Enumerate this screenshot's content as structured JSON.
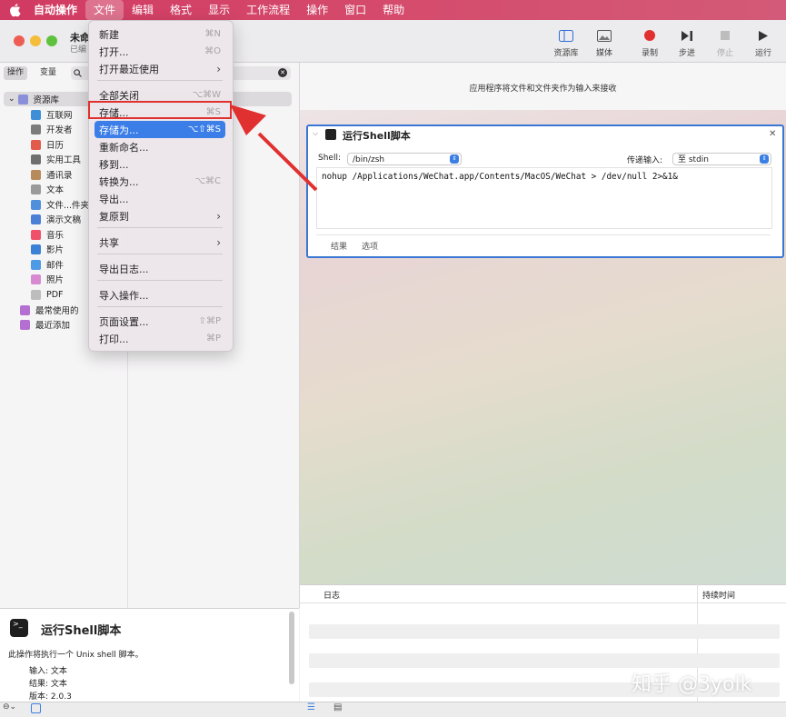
{
  "menubar": {
    "items": [
      "自动操作",
      "文件",
      "编辑",
      "格式",
      "显示",
      "工作流程",
      "操作",
      "窗口",
      "帮助"
    ],
    "active_index": 1
  },
  "window": {
    "title": "未命",
    "subtitle": "已编"
  },
  "toolbar": {
    "library": "资源库",
    "media": "媒体",
    "record": "录制",
    "step": "步进",
    "stop": "停止",
    "run": "运行"
  },
  "left_tabs": {
    "actions": "操作",
    "variables": "变量"
  },
  "library_tree": [
    {
      "label": "资源库",
      "color": "#8a8fd9"
    },
    {
      "label": "互联网",
      "color": "#3f8fd8"
    },
    {
      "label": "开发者",
      "color": "#7c7c7c"
    },
    {
      "label": "日历",
      "color": "#e25a4b"
    },
    {
      "label": "实用工具",
      "color": "#6f6f6f"
    },
    {
      "label": "通讯录",
      "color": "#b78a5b"
    },
    {
      "label": "文本",
      "color": "#9a9a9a"
    },
    {
      "label": "文件...件夹",
      "color": "#4f8fdc"
    },
    {
      "label": "演示文稿",
      "color": "#4c7fd6"
    },
    {
      "label": "音乐",
      "color": "#f0506a"
    },
    {
      "label": "影片",
      "color": "#3b82d6"
    },
    {
      "label": "邮件",
      "color": "#4d9be6"
    },
    {
      "label": "照片",
      "color": "#d78ad0"
    },
    {
      "label": "PDF",
      "color": "#bdbdbd"
    },
    {
      "label": "最常使用的",
      "color": "#b46fd2"
    },
    {
      "label": "最近添加",
      "color": "#b46fd2"
    }
  ],
  "file_menu": [
    {
      "label": "新建",
      "shortcut": "⌘N"
    },
    {
      "label": "打开...",
      "shortcut": "⌘O"
    },
    {
      "label": "打开最近使用",
      "shortcut": ""
    },
    {
      "label": "全部关闭",
      "shortcut": "⌥⌘W"
    },
    {
      "label": "存储...",
      "shortcut": "⌘S"
    },
    {
      "label": "存储为...",
      "shortcut": "⌥⇧⌘S"
    },
    {
      "label": "重新命名...",
      "shortcut": ""
    },
    {
      "label": "移到...",
      "shortcut": ""
    },
    {
      "label": "转换为...",
      "shortcut": "⌥⌘C"
    },
    {
      "label": "导出...",
      "shortcut": ""
    },
    {
      "label": "复原到",
      "shortcut": ""
    },
    {
      "label": "共享",
      "shortcut": ""
    },
    {
      "label": "导出日志...",
      "shortcut": ""
    },
    {
      "label": "导入操作...",
      "shortcut": ""
    },
    {
      "label": "页面设置...",
      "shortcut": "⇧⌘P"
    },
    {
      "label": "打印...",
      "shortcut": "⌘P"
    }
  ],
  "workflow": {
    "hint": "应用程序将文件和文件夹作为输入来接收",
    "action_title": "运行Shell脚本",
    "shell_label": "Shell:",
    "shell_value": "/bin/zsh",
    "input_label": "传递输入:",
    "input_value": "至 stdin",
    "script": "nohup /Applications/WeChat.app/Contents/MacOS/WeChat > /dev/null 2>&1&",
    "results_tab": "结果",
    "options_tab": "选项"
  },
  "log": {
    "col_log": "日志",
    "col_duration": "持续时间"
  },
  "description": {
    "title": "运行Shell脚本",
    "body": "此操作将执行一个 Unix shell 脚本。",
    "input": "输入: 文本",
    "result": "结果: 文本",
    "version": "版本: 2.0.3"
  },
  "watermark": "知乎 @3yolk",
  "colors": {
    "accent": "#3c7ee8",
    "highlight_box": "#e0302f",
    "menubar": "#d44468"
  }
}
